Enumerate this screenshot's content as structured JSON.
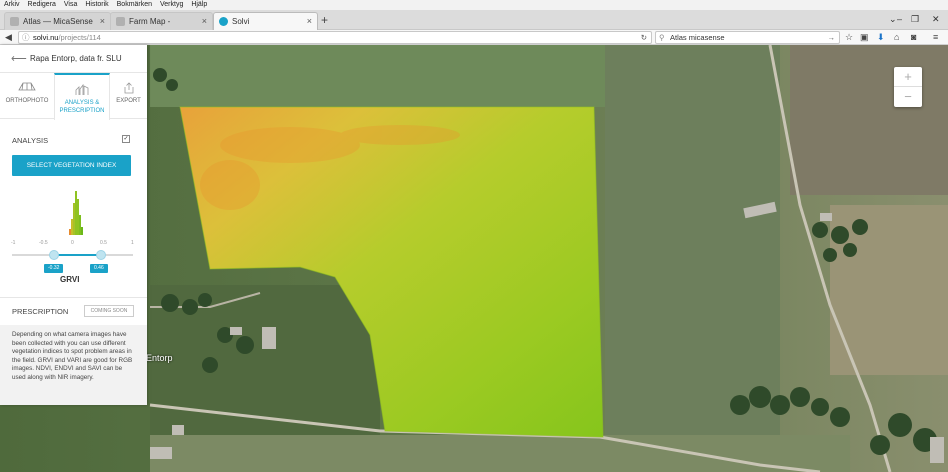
{
  "browser": {
    "menu": [
      "Arkiv",
      "Redigera",
      "Visa",
      "Historik",
      "Bokmärken",
      "Verktyg",
      "Hjälp"
    ],
    "tabs": [
      {
        "label": "Atlas — MicaSense",
        "active": false
      },
      {
        "label": "Farm Map - MicaSense",
        "active": false
      },
      {
        "label": "Solvi",
        "active": true
      }
    ],
    "url_host": "solvi.nu",
    "url_path": "/projects/114",
    "search_value": "Atlas micasense"
  },
  "panel": {
    "title": "Rapa Entorp, data fr. SLU",
    "tabs": [
      {
        "label": "ORTHOPHOTO",
        "active": false
      },
      {
        "label": "ANALYSIS & PRESCRIPTION",
        "active": true
      },
      {
        "label": "EXPORT",
        "active": false
      }
    ],
    "analysis_label": "ANALYSIS",
    "analysis_checked": true,
    "veg_button": "SELECT VEGETATION INDEX",
    "ticks": [
      "-1",
      "-0.5",
      "0",
      "0.5",
      "1"
    ],
    "range_min": "-0.32",
    "range_max": "0.46",
    "index_name": "GRVI",
    "prescription_label": "PRESCRIPTION",
    "coming_soon": "COMING SOON",
    "info_text": "Depending on what camera images have been collected with you can use different vegetation indices to spot problem areas in the field. GRVI and VARI are good for RGB images. NDVI, ENDVI and SAVI can be used along with NIR imagery."
  },
  "map": {
    "label": "Entorp",
    "zoom_in": "+",
    "zoom_out": "−"
  },
  "colors": {
    "accent": "#1aa2c8"
  }
}
